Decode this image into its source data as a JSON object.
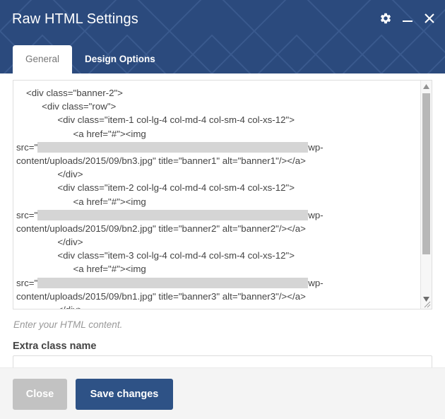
{
  "window": {
    "title": "Raw HTML Settings",
    "controls": [
      {
        "name": "settings-gear",
        "label": "Settings"
      },
      {
        "name": "minimize",
        "label": "Minimize"
      },
      {
        "name": "close",
        "label": "Close"
      }
    ]
  },
  "tabs": [
    {
      "label": "General",
      "active": true
    },
    {
      "label": "Design Options",
      "active": false
    }
  ],
  "editor": {
    "lines": [
      {
        "text": "<div class=\"banner-2\">",
        "indent": "indent1"
      },
      {
        "text": "      <div class=\"row\">",
        "indent": "indent1"
      },
      {
        "text": "            <div class=\"item-1 col-lg-4 col-md-4 col-sm-4 col-xs-12\">",
        "indent": "indent1"
      },
      {
        "text": "                  <a href=\"#\"><img",
        "indent": "indent1"
      },
      {
        "prefix": "src=\"",
        "redacted": true,
        "suffix": "wp-",
        "indent": "flush"
      },
      {
        "text": "content/uploads/2015/09/bn3.jpg\" title=\"banner1\" alt=\"banner1\"/></a>",
        "indent": "flush"
      },
      {
        "text": "            </div>",
        "indent": "indent1"
      },
      {
        "text": "            <div class=\"item-2 col-lg-4 col-md-4 col-sm-4 col-xs-12\">",
        "indent": "indent1"
      },
      {
        "text": "                  <a href=\"#\"><img",
        "indent": "indent1"
      },
      {
        "prefix": "src=\"",
        "redacted": true,
        "suffix": "wp-",
        "indent": "flush"
      },
      {
        "text": "content/uploads/2015/09/bn2.jpg\" title=\"banner2\" alt=\"banner2\"/></a>",
        "indent": "flush"
      },
      {
        "text": "            </div>",
        "indent": "indent1"
      },
      {
        "text": "            <div class=\"item-3 col-lg-4 col-md-4 col-sm-4 col-xs-12\">",
        "indent": "indent1"
      },
      {
        "text": "                  <a href=\"#\"><img",
        "indent": "indent1"
      },
      {
        "prefix": "src=\"",
        "redacted": true,
        "suffix": "wp-",
        "indent": "flush"
      },
      {
        "text": "content/uploads/2015/09/bn1.jpg\" title=\"banner3\" alt=\"banner3\"/></a>",
        "indent": "flush"
      },
      {
        "text": "            </div>",
        "indent": "indent1"
      }
    ],
    "help_text": "Enter your HTML content."
  },
  "extra_class": {
    "label": "Extra class name",
    "value": "",
    "placeholder": ""
  },
  "footer": {
    "close_label": "Close",
    "save_label": "Save changes"
  },
  "colors": {
    "header_blue": "#2b4a7d",
    "save_blue": "#2e5286",
    "close_gray": "#c2c2c2",
    "footer_bg": "#f4f4f4",
    "redaction_gray": "#d5d5d5"
  }
}
